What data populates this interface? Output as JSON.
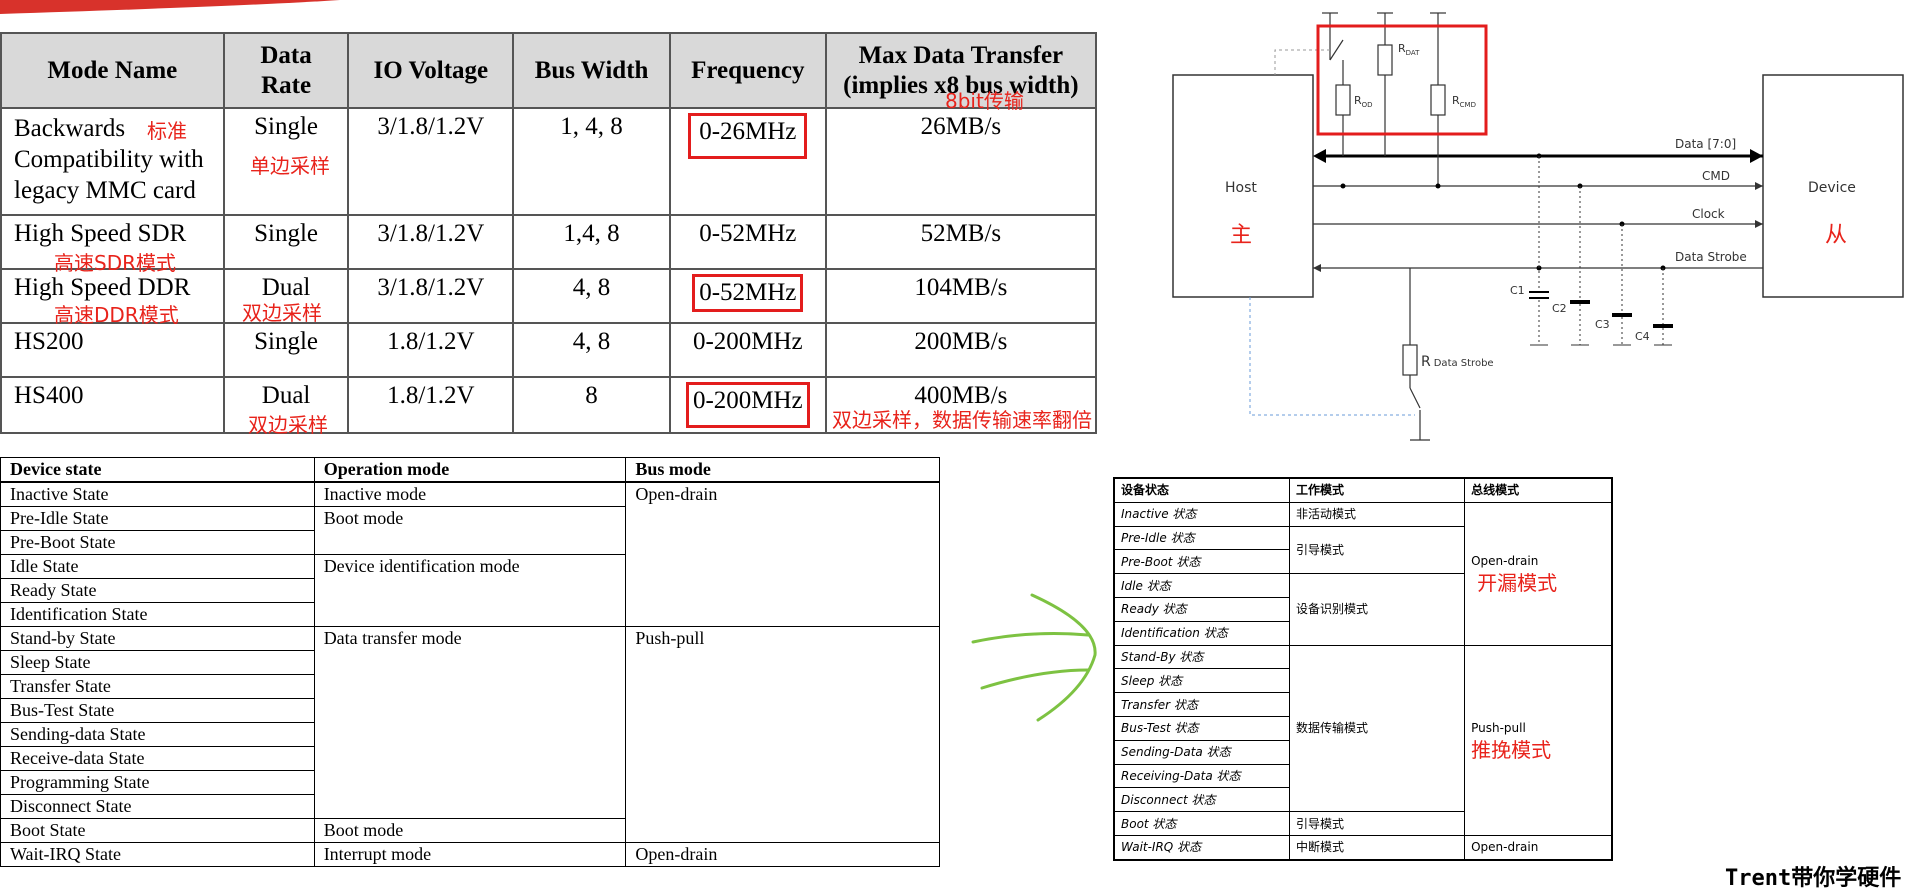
{
  "mode_table": {
    "headers": [
      "Mode Name",
      "Data Rate",
      "IO Voltage",
      "Bus Width",
      "Frequency",
      "Max Data Transfer (implies x8 bus width)"
    ],
    "header_lines": {
      "data_rate": [
        "Data",
        "Rate"
      ],
      "max_transfer": [
        "Max Data Transfer",
        "(implies x8 bus width)"
      ]
    },
    "rows": [
      {
        "mode_lines": [
          "Backwards",
          "Compatibility with",
          "legacy MMC card"
        ],
        "rate": "Single",
        "io": "3/1.8/1.2V",
        "bus": "1, 4, 8",
        "freq": "0-26MHz",
        "max": "26MB/s"
      },
      {
        "mode_lines": [
          "High Speed SDR"
        ],
        "rate": "Single",
        "io": "3/1.8/1.2V",
        "bus": "1,4, 8",
        "freq": "0-52MHz",
        "max": "52MB/s"
      },
      {
        "mode_lines": [
          "High Speed DDR"
        ],
        "rate": "Dual",
        "io": "3/1.8/1.2V",
        "bus": "4, 8",
        "freq": "0-52MHz",
        "max": "104MB/s"
      },
      {
        "mode_lines": [
          "HS200"
        ],
        "rate": "Single",
        "io": "1.8/1.2V",
        "bus": "4, 8",
        "freq": "0-200MHz",
        "max": "200MB/s"
      },
      {
        "mode_lines": [
          "HS400"
        ],
        "rate": "Dual",
        "io": "1.8/1.2V",
        "bus": "8",
        "freq": "0-200MHz",
        "max": "400MB/s"
      }
    ]
  },
  "annotations": {
    "standard": "标准",
    "single_edge": "单边采样",
    "eight_bit": "8bit传输",
    "hs_sdr": "高速SDR模式",
    "hs_ddr": "高速DDR模式",
    "dual_edge_1": "双边采样",
    "dual_edge_2": "双边采样",
    "dual_rate_note": "双边采样，数据传输速率翻倍",
    "host_cn": "主",
    "device_cn": "从",
    "open_drain_cn": "开漏模式",
    "push_pull_cn": "推挽模式"
  },
  "diagram": {
    "host": "Host",
    "device": "Device",
    "signals": [
      "Data [7:0]",
      "CMD",
      "Clock",
      "Data Strobe"
    ],
    "resistors": {
      "rdat": "DAT",
      "rod": "OD",
      "rcmd": "CMD",
      "rds_main": "R",
      "rds_sub": "Data Strobe"
    },
    "caps": [
      "C1",
      "C2",
      "C3",
      "C4"
    ]
  },
  "state_table": {
    "headers": [
      "Device state",
      "Operation mode",
      "Bus mode"
    ],
    "states": [
      "Inactive State",
      "Pre-Idle State",
      "Pre-Boot State",
      "Idle State",
      "Ready State",
      "Identification State",
      "Stand-by State",
      "Sleep State",
      "Transfer State",
      "Bus-Test State",
      "Sending-data State",
      "Receive-data State",
      "Programming State",
      "Disconnect State",
      "Boot State",
      "Wait-IRQ State"
    ],
    "op_modes": [
      "Inactive mode",
      "Boot mode",
      "Device identification mode",
      "Data transfer mode",
      "Boot mode",
      "Interrupt mode"
    ],
    "bus_modes": [
      "Open-drain",
      "Push-pull",
      "Open-drain"
    ]
  },
  "cn_table": {
    "headers": [
      "设备状态",
      "工作模式",
      "总线模式"
    ],
    "states": [
      "Inactive 状态",
      "Pre-Idle 状态",
      "Pre-Boot 状态",
      "Idle 状态",
      "Ready 状态",
      "Identification 状态",
      "Stand-By 状态",
      "Sleep 状态",
      "Transfer 状态",
      "Bus-Test 状态",
      "Sending-Data 状态",
      "Receiving-Data 状态",
      "Disconnect 状态",
      "Boot 状态",
      "Wait-IRQ 状态"
    ],
    "op_modes": [
      "非活动模式",
      "引导模式",
      "设备识别模式",
      "数据传输模式",
      "引导模式",
      "中断模式"
    ],
    "bus_modes": [
      "Open-drain",
      "Push-pull",
      "Open-drain"
    ]
  },
  "watermark": "Trent带你学硬件",
  "colors": {
    "annotation": "#e8231b",
    "arrow": "#7dc242",
    "header_bg": "#d9d9d9"
  }
}
